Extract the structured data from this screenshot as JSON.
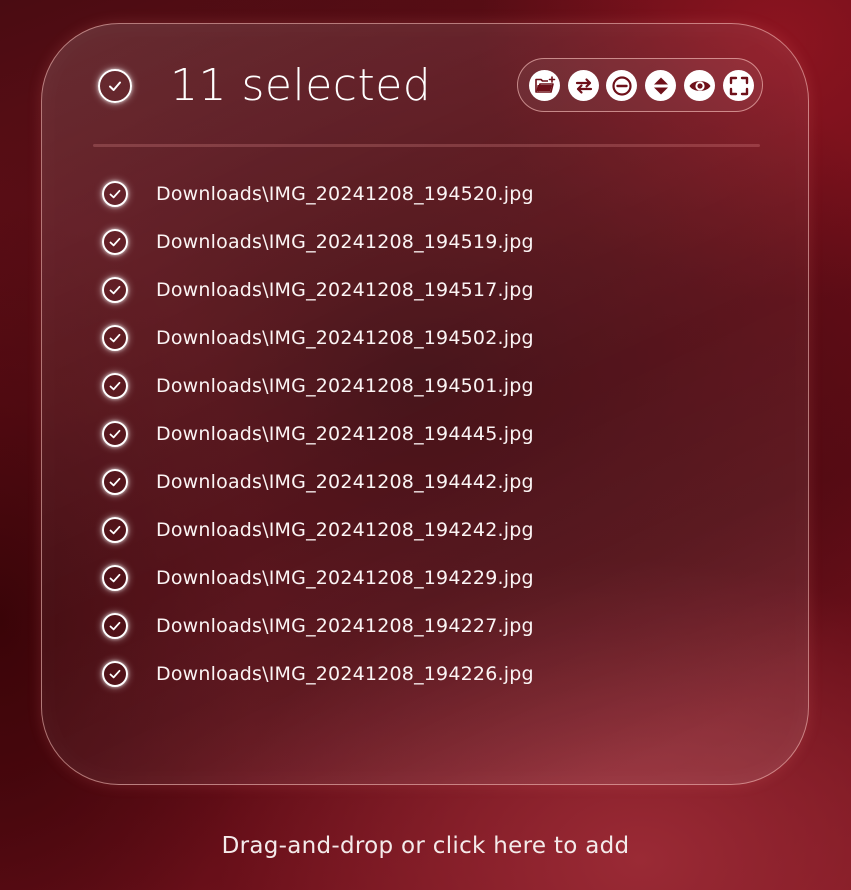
{
  "header": {
    "title": "11 selected",
    "select_all_icon": "check-circle-icon",
    "toolbar": [
      {
        "name": "add-folder-button",
        "icon": "folder-plus-icon"
      },
      {
        "name": "swap-button",
        "icon": "arrows-swap-icon"
      },
      {
        "name": "remove-button",
        "icon": "minus-circle-icon"
      },
      {
        "name": "sort-button",
        "icon": "sort-updown-icon"
      },
      {
        "name": "preview-button",
        "icon": "eye-icon"
      },
      {
        "name": "select-area-button",
        "icon": "focus-frame-icon"
      }
    ]
  },
  "files": [
    "Downloads\\IMG_20241208_194520.jpg",
    "Downloads\\IMG_20241208_194519.jpg",
    "Downloads\\IMG_20241208_194517.jpg",
    "Downloads\\IMG_20241208_194502.jpg",
    "Downloads\\IMG_20241208_194501.jpg",
    "Downloads\\IMG_20241208_194445.jpg",
    "Downloads\\IMG_20241208_194442.jpg",
    "Downloads\\IMG_20241208_194242.jpg",
    "Downloads\\IMG_20241208_194229.jpg",
    "Downloads\\IMG_20241208_194227.jpg",
    "Downloads\\IMG_20241208_194226.jpg"
  ],
  "footer": {
    "drop_text": "Drag-and-drop or click here to add"
  },
  "colors": {
    "background": "#5a0b14",
    "icon_fill": "#6e1019",
    "border": "#ffc8c3"
  }
}
